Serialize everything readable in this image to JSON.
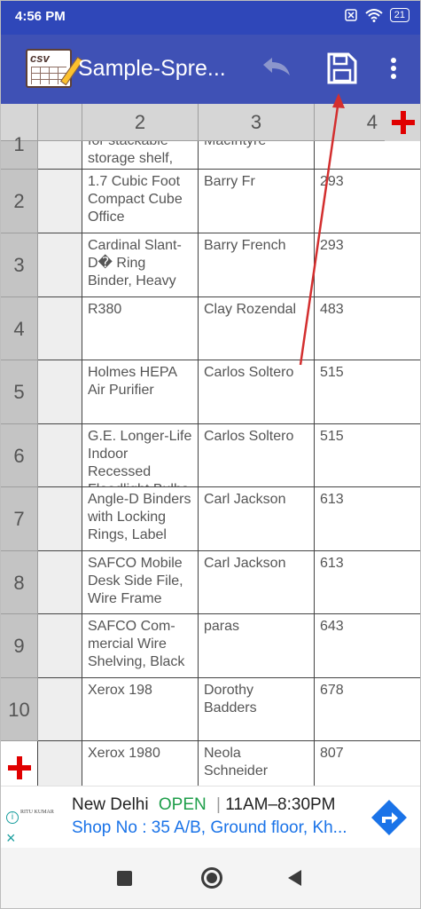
{
  "status_bar": {
    "time": "4:56 PM",
    "battery": "21"
  },
  "app_bar": {
    "logo_text": "csv",
    "title": "Sample-Spre...",
    "undo_icon": "undo-icon",
    "save_icon": "save-icon",
    "more_icon": "more-vert-icon"
  },
  "sheet": {
    "column_headers": [
      "",
      "2",
      "3",
      "4"
    ],
    "add_column_icon": "plus-icon",
    "add_row_icon": "plus-icon",
    "rows": [
      {
        "num": "1",
        "c1": "",
        "c2": "for stackable storage shelf,",
        "c3": "MacIntyre",
        "c4": ""
      },
      {
        "num": "2",
        "c1": "",
        "c2": "1.7 Cubic Foot Compact Cube Office",
        "c3": "Barry Fr",
        "c4": "293"
      },
      {
        "num": "3",
        "c1": "",
        "c2": "Cardinal Slant-D� Ring Binder, Heavy",
        "c3": "Barry French",
        "c4": "293"
      },
      {
        "num": "4",
        "c1": "",
        "c2": "R380",
        "c3": "Clay Rozendal",
        "c4": "483"
      },
      {
        "num": "5",
        "c1": "",
        "c2": "Holmes HEPA Air Purifier",
        "c3": "Carlos Soltero",
        "c4": "515"
      },
      {
        "num": "6",
        "c1": "",
        "c2": "G.E. Longer-Life Indoor Recessed Floodlight Bulbs",
        "c3": "Carlos Soltero",
        "c4": "515"
      },
      {
        "num": "7",
        "c1": "",
        "c2": "Angle-D Binders with Locking Rings, Label",
        "c3": "Carl Jackson",
        "c4": "613"
      },
      {
        "num": "8",
        "c1": "",
        "c2": "SAFCO Mobile Desk Side File, Wire Frame",
        "c3": "Carl Jackson",
        "c4": "613"
      },
      {
        "num": "9",
        "c1": "",
        "c2": "SAFCO Com-mercial Wire Shelving, Black",
        "c3": "paras",
        "c4": "643"
      },
      {
        "num": "10",
        "c1": "",
        "c2": "Xerox 198",
        "c3": "Dorothy Badders",
        "c4": "678"
      },
      {
        "num": "",
        "c1": "",
        "c2": "Xerox 1980",
        "c3": "Neola Schneider",
        "c4": "807"
      }
    ]
  },
  "ad": {
    "brand": "RITU KUMAR",
    "city": "New Delhi",
    "status": "OPEN",
    "hours": "11AM–8:30PM",
    "address": "Shop No : 35 A/B, Ground floor, Kh...",
    "close_label": "×",
    "info_label": "i",
    "go_icon": "directions-icon"
  },
  "nav_bar": {
    "recent_icon": "recents-icon",
    "home_icon": "home-icon",
    "back_icon": "back-icon"
  },
  "colors": {
    "app_bar": "#3f51b5",
    "status_bar": "#2f47b9",
    "accent_red": "#e00000",
    "ad_open": "#1e9e4a",
    "ad_link": "#1a73e8"
  }
}
